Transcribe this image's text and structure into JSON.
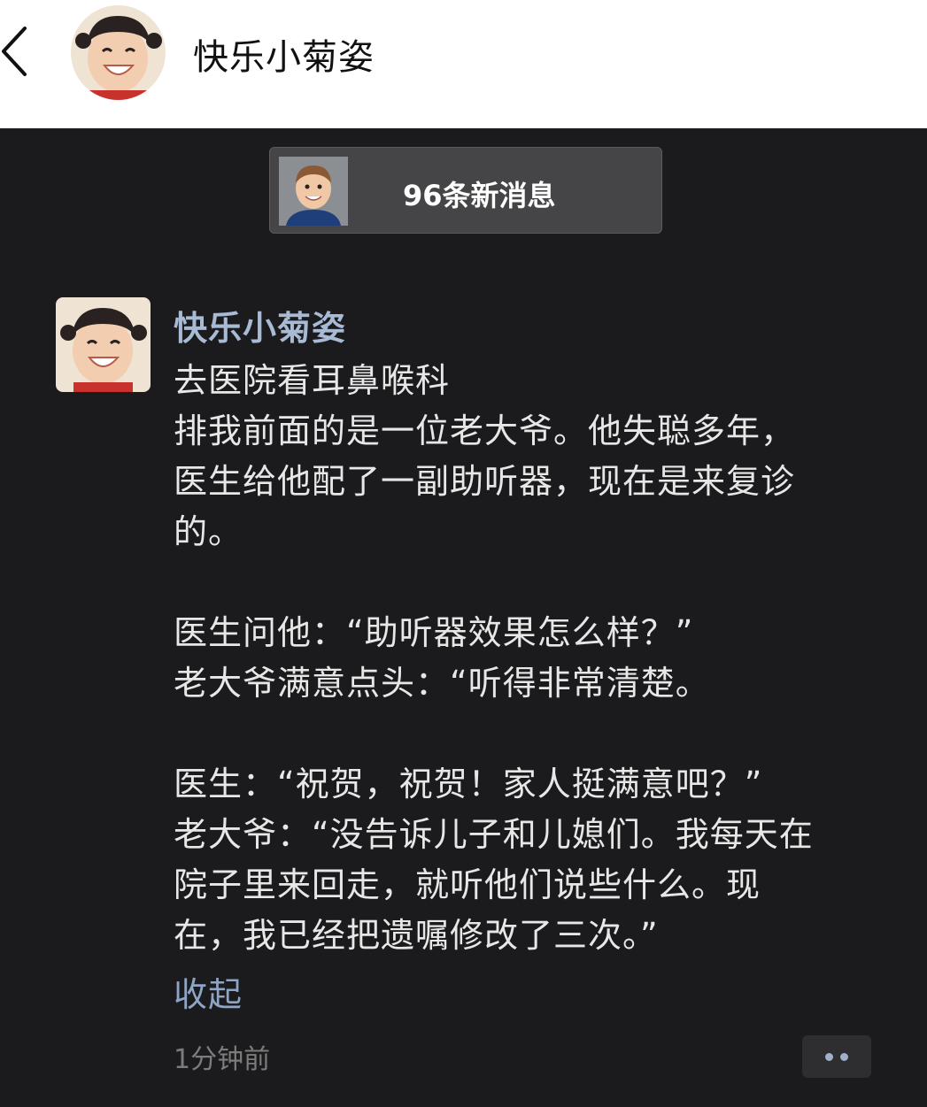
{
  "header": {
    "title": "快乐小菊姿"
  },
  "new_messages": {
    "label": "96条新消息"
  },
  "post": {
    "author": "快乐小菊姿",
    "lines": [
      "去医院看耳鼻喉科",
      "排我前面的是一位老大爷。他失聪多年，",
      "医生给他配了一副助听器，现在是来复诊",
      "的。",
      "",
      "医生问他：“助听器效果怎么样？”",
      "老大爷满意点头：“听得非常清楚。",
      "",
      "医生：“祝贺，祝贺！家人挺满意吧？”",
      "老大爷：“没告诉儿子和儿媳们。我每天在",
      "院子里来回走，就听他们说些什么。现",
      "在，我已经把遗嘱修改了三次。”"
    ],
    "collapse_label": "收起",
    "timestamp": "1分钟前"
  },
  "icons": {
    "back": "chevron-left-icon",
    "more": "more-dots-icon"
  },
  "colors": {
    "header_bg": "#ffffff",
    "panel_bg": "#1b1b1d",
    "author_link": "#a8bad4",
    "collapse_link": "#8ea5c6",
    "body_text": "#e7e7e7",
    "timestamp": "#7c7c7c"
  }
}
